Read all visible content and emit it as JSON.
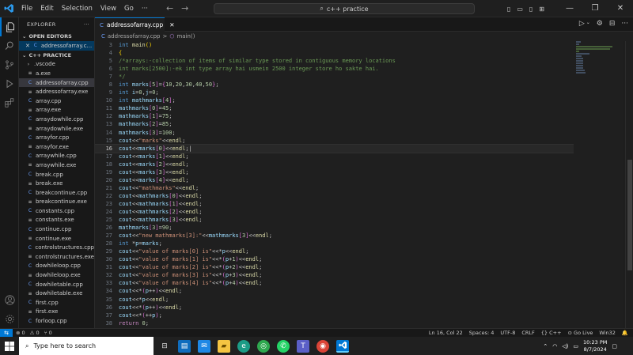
{
  "titlebar": {
    "menu": [
      "File",
      "Edit",
      "Selection",
      "View",
      "Go",
      "···"
    ],
    "search_text": "c++ practice",
    "colors": {
      "accent": "#0078d4"
    }
  },
  "sidebar": {
    "title": "EXPLORER",
    "title_more": "···",
    "open_editors_label": "OPEN EDITORS",
    "open_editor_file": "addressofarray.c...",
    "folder_label": "C++ PRACTICE",
    "items": [
      {
        "label": ".vscode",
        "kind": "folder"
      },
      {
        "label": "a.exe",
        "kind": "exe"
      },
      {
        "label": "addressofarray.cpp",
        "kind": "cpp",
        "selected": true
      },
      {
        "label": "addressofarray.exe",
        "kind": "exe"
      },
      {
        "label": "array.cpp",
        "kind": "cpp"
      },
      {
        "label": "array.exe",
        "kind": "exe"
      },
      {
        "label": "arraydowhile.cpp",
        "kind": "cpp"
      },
      {
        "label": "arraydowhile.exe",
        "kind": "exe"
      },
      {
        "label": "arrayfor.cpp",
        "kind": "cpp"
      },
      {
        "label": "arrayfor.exe",
        "kind": "exe"
      },
      {
        "label": "arraywhile.cpp",
        "kind": "cpp"
      },
      {
        "label": "arraywhile.exe",
        "kind": "exe"
      },
      {
        "label": "break.cpp",
        "kind": "cpp"
      },
      {
        "label": "break.exe",
        "kind": "exe"
      },
      {
        "label": "breakcontinue.cpp",
        "kind": "cpp"
      },
      {
        "label": "breakcontinue.exe",
        "kind": "exe"
      },
      {
        "label": "constants.cpp",
        "kind": "cpp"
      },
      {
        "label": "constants.exe",
        "kind": "exe"
      },
      {
        "label": "continue.cpp",
        "kind": "cpp"
      },
      {
        "label": "continue.exe",
        "kind": "exe"
      },
      {
        "label": "controlstructures.cpp",
        "kind": "cpp"
      },
      {
        "label": "controlstructures.exe",
        "kind": "exe"
      },
      {
        "label": "dowhileloop.cpp",
        "kind": "cpp"
      },
      {
        "label": "dowhileloop.exe",
        "kind": "exe"
      },
      {
        "label": "dowhiletable.cpp",
        "kind": "cpp"
      },
      {
        "label": "dowhiletable.exe",
        "kind": "exe"
      },
      {
        "label": "first.cpp",
        "kind": "cpp"
      },
      {
        "label": "first.exe",
        "kind": "exe"
      },
      {
        "label": "forloop.cpp",
        "kind": "cpp"
      }
    ]
  },
  "editor": {
    "tab_label": "addressofarray.cpp",
    "breadcrumb_file": "addressofarray.cpp",
    "breadcrumb_sep": ">",
    "breadcrumb_symbol": "main()",
    "current_line": 16,
    "lines": [
      {
        "n": 3,
        "html": "<span class=\"ty\">int</span> <span class=\"fn\">main</span><span class=\"brk\">()</span>"
      },
      {
        "n": 4,
        "html": "<span class=\"brk\">{</span>"
      },
      {
        "n": 5,
        "html": "<span class=\"cm\">/*arrays:-collection of items of similar type stored in contiguous memory locations</span>"
      },
      {
        "n": 6,
        "html": "<span class=\"cm\">int marks[2500]:-ek int type array hai usmein 2500 integer store ho sakte hai.</span>"
      },
      {
        "n": 7,
        "html": "<span class=\"cm\">*/</span>"
      },
      {
        "n": 8,
        "html": "<span class=\"ty\">int</span> <span class=\"vr\">marks</span><span class=\"brk2\">[</span><span class=\"nm\">5</span><span class=\"brk2\">]</span>=<span class=\"brk2\">{</span><span class=\"nm\">10</span>,<span class=\"nm\">20</span>,<span class=\"nm\">30</span>,<span class=\"nm\">40</span>,<span class=\"nm\">50</span><span class=\"brk2\">}</span>;"
      },
      {
        "n": 9,
        "html": "<span class=\"ty\">int</span> <span class=\"vr\">i</span>=<span class=\"nm\">0</span>,<span class=\"vr\">j</span>=<span class=\"nm\">0</span>;"
      },
      {
        "n": 10,
        "html": "<span class=\"ty\">int</span> <span class=\"vr\">mathmarks</span><span class=\"brk2\">[</span><span class=\"nm\">4</span><span class=\"brk2\">]</span>;"
      },
      {
        "n": 11,
        "html": "<span class=\"vr\">mathmarks</span><span class=\"brk2\">[</span><span class=\"nm\">0</span><span class=\"brk2\">]</span>=<span class=\"nm\">45</span>;"
      },
      {
        "n": 12,
        "html": "<span class=\"vr\">mathmarks</span><span class=\"brk2\">[</span><span class=\"nm\">1</span><span class=\"brk2\">]</span>=<span class=\"nm\">75</span>;"
      },
      {
        "n": 13,
        "html": "<span class=\"vr\">mathmarks</span><span class=\"brk2\">[</span><span class=\"nm\">2</span><span class=\"brk2\">]</span>=<span class=\"nm\">85</span>;"
      },
      {
        "n": 14,
        "html": "<span class=\"vr\">mathmarks</span><span class=\"brk2\">[</span><span class=\"nm\">3</span><span class=\"brk2\">]</span>=<span class=\"nm\">100</span>;"
      },
      {
        "n": 15,
        "html": "<span class=\"vr\">cout</span>&lt;&lt;<span class=\"str\">\"marks\"</span>&lt;&lt;<span class=\"fn\">endl</span>;"
      },
      {
        "n": 16,
        "html": "<span class=\"vr\">cout</span>&lt;&lt;<span class=\"vr\">marks</span><span class=\"brk2\">[</span><span class=\"nm\">0</span><span class=\"brk2\">]</span>&lt;&lt;<span class=\"fn\">endl</span>;|"
      },
      {
        "n": 17,
        "html": "<span class=\"vr\">cout</span>&lt;&lt;<span class=\"vr\">marks</span><span class=\"brk2\">[</span><span class=\"nm\">1</span><span class=\"brk2\">]</span>&lt;&lt;<span class=\"fn\">endl</span>;"
      },
      {
        "n": 18,
        "html": "<span class=\"vr\">cout</span>&lt;&lt;<span class=\"vr\">marks</span><span class=\"brk2\">[</span><span class=\"nm\">2</span><span class=\"brk2\">]</span>&lt;&lt;<span class=\"fn\">endl</span>;"
      },
      {
        "n": 19,
        "html": "<span class=\"vr\">cout</span>&lt;&lt;<span class=\"vr\">marks</span><span class=\"brk2\">[</span><span class=\"nm\">3</span><span class=\"brk2\">]</span>&lt;&lt;<span class=\"fn\">endl</span>;"
      },
      {
        "n": 20,
        "html": "<span class=\"vr\">cout</span>&lt;&lt;<span class=\"vr\">marks</span><span class=\"brk2\">[</span><span class=\"nm\">4</span><span class=\"brk2\">]</span>&lt;&lt;<span class=\"fn\">endl</span>;"
      },
      {
        "n": 21,
        "html": "<span class=\"vr\">cout</span>&lt;&lt;<span class=\"str\">\"mathmarks\"</span>&lt;&lt;<span class=\"fn\">endl</span>;"
      },
      {
        "n": 22,
        "html": "<span class=\"vr\">cout</span>&lt;&lt;<span class=\"vr\">mathmarks</span><span class=\"brk2\">[</span><span class=\"nm\">0</span><span class=\"brk2\">]</span>&lt;&lt;<span class=\"fn\">endl</span>;"
      },
      {
        "n": 23,
        "html": "<span class=\"vr\">cout</span>&lt;&lt;<span class=\"vr\">mathmarks</span><span class=\"brk2\">[</span><span class=\"nm\">1</span><span class=\"brk2\">]</span>&lt;&lt;<span class=\"fn\">endl</span>;"
      },
      {
        "n": 24,
        "html": "<span class=\"vr\">cout</span>&lt;&lt;<span class=\"vr\">mathmarks</span><span class=\"brk2\">[</span><span class=\"nm\">2</span><span class=\"brk2\">]</span>&lt;&lt;<span class=\"fn\">endl</span>;"
      },
      {
        "n": 25,
        "html": "<span class=\"vr\">cout</span>&lt;&lt;<span class=\"vr\">mathmarks</span><span class=\"brk2\">[</span><span class=\"nm\">3</span><span class=\"brk2\">]</span>&lt;&lt;<span class=\"fn\">endl</span>;"
      },
      {
        "n": 26,
        "html": "<span class=\"vr\">mathmarks</span><span class=\"brk2\">[</span><span class=\"nm\">3</span><span class=\"brk2\">]</span>=<span class=\"nm\">90</span>;"
      },
      {
        "n": 27,
        "html": "<span class=\"vr\">cout</span>&lt;&lt;<span class=\"str\">\"new mathmarks[3]:\"</span>&lt;&lt;<span class=\"vr\">mathmarks</span><span class=\"brk2\">[</span><span class=\"nm\">3</span><span class=\"brk2\">]</span>&lt;&lt;<span class=\"fn\">endl</span>;"
      },
      {
        "n": 28,
        "html": "<span class=\"ty\">int</span> *<span class=\"vr\">p</span>=<span class=\"vr\">marks</span>;"
      },
      {
        "n": 29,
        "html": "<span class=\"vr\">cout</span>&lt;&lt;<span class=\"str\">\"value of marks[0] is\"</span>&lt;&lt;*<span class=\"vr\">p</span>&lt;&lt;<span class=\"fn\">endl</span>;"
      },
      {
        "n": 30,
        "html": "<span class=\"vr\">cout</span>&lt;&lt;<span class=\"str\">\"value of marks[1] is\"</span>&lt;&lt;*<span class=\"brk2\">(</span><span class=\"vr\">p</span>+<span class=\"nm\">1</span><span class=\"brk2\">)</span>&lt;&lt;<span class=\"fn\">endl</span>;"
      },
      {
        "n": 31,
        "html": "<span class=\"vr\">cout</span>&lt;&lt;<span class=\"str\">\"value of marks[2] is\"</span>&lt;&lt;*<span class=\"brk2\">(</span><span class=\"vr\">p</span>+<span class=\"nm\">2</span><span class=\"brk2\">)</span>&lt;&lt;<span class=\"fn\">endl</span>;"
      },
      {
        "n": 32,
        "html": "<span class=\"vr\">cout</span>&lt;&lt;<span class=\"str\">\"value of marks[3] is\"</span>&lt;&lt;*<span class=\"brk2\">(</span><span class=\"vr\">p</span>+<span class=\"nm\">3</span><span class=\"brk2\">)</span>&lt;&lt;<span class=\"fn\">endl</span>;"
      },
      {
        "n": 33,
        "html": "<span class=\"vr\">cout</span>&lt;&lt;<span class=\"str\">\"value of marks[4] is\"</span>&lt;&lt;*<span class=\"brk2\">(</span><span class=\"vr\">p</span>+<span class=\"nm\">4</span><span class=\"brk2\">)</span>&lt;&lt;<span class=\"fn\">endl</span>;"
      },
      {
        "n": 34,
        "html": "<span class=\"vr\">cout</span>&lt;&lt;*<span class=\"brk2\">(</span><span class=\"vr\">p</span>++<span class=\"brk2\">)</span>&lt;&lt;<span class=\"fn\">endl</span>;"
      },
      {
        "n": 35,
        "html": "<span class=\"vr\">cout</span>&lt;&lt;*<span class=\"vr\">p</span>&lt;&lt;<span class=\"fn\">endl</span>;"
      },
      {
        "n": 36,
        "html": "<span class=\"vr\">cout</span>&lt;&lt;*<span class=\"brk2\">(</span><span class=\"vr\">p</span>++<span class=\"brk2\">)</span>&lt;&lt;<span class=\"fn\">endl</span>;"
      },
      {
        "n": 37,
        "html": "<span class=\"vr\">cout</span>&lt;&lt;*<span class=\"brk2\">(</span>++<span class=\"vr\">p</span><span class=\"brk2\">)</span>;"
      },
      {
        "n": 38,
        "html": "<span class=\"ctl\">return</span> <span class=\"nm\">0</span>;"
      },
      {
        "n": 39,
        "html": "<span class=\"brk\">}</span>"
      }
    ]
  },
  "statusbar": {
    "remote_glyph": "⇆",
    "errors": "⊗ 0",
    "warnings": "⚠ 0",
    "ports": "⑂ 0",
    "position": "Ln 16, Col 22",
    "spaces": "Spaces: 4",
    "encoding": "UTF-8",
    "eol": "CRLF",
    "language": "{} C++",
    "golive": "⊙ Go Live",
    "platform": "Win32",
    "bell": "🔔"
  },
  "taskbar": {
    "search_placeholder": "Type here to search",
    "time": "10:23 PM",
    "date": "8/7/2024"
  }
}
